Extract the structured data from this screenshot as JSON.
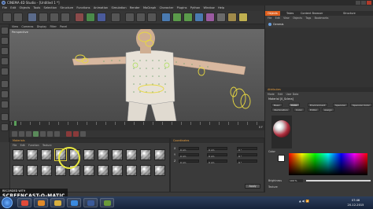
{
  "window": {
    "title": "CINEMA 4D Studio - [Untitled 1 *]",
    "colors": {
      "accent": "#e0601e",
      "background": "#3a3a3a"
    }
  },
  "menubar": [
    "File",
    "Edit",
    "Objects",
    "Tools",
    "Selection",
    "Structure",
    "Functions",
    "Animation",
    "Simulation",
    "Render",
    "MoGraph",
    "Character",
    "Plugins",
    "Python",
    "Window",
    "Help"
  ],
  "viewport": {
    "menu": [
      "View",
      "Cameras",
      "Display",
      "Filter",
      "Panel"
    ],
    "label": "Perspective"
  },
  "timeline": {
    "frame_label": "0 F"
  },
  "material_manager": {
    "header": "Materials",
    "menu": [
      "File",
      "Edit",
      "Function",
      "Texture"
    ]
  },
  "coordinates": {
    "header": "Coordinates",
    "rows": [
      {
        "axis": "X",
        "pos": "0 cm",
        "size": "0 cm",
        "rot": "0 °"
      },
      {
        "axis": "Y",
        "pos": "0 cm",
        "size": "0 cm",
        "rot": "0 °"
      },
      {
        "axis": "Z",
        "pos": "0 cm",
        "size": "0 cm",
        "rot": "0 °"
      }
    ],
    "apply_label": "Apply"
  },
  "object_manager": {
    "tabs": [
      "Objects",
      "Takes",
      "Content Browser",
      "Structure"
    ],
    "menu": [
      "File",
      "Edit",
      "View",
      "Objects",
      "Tags",
      "Bookmarks"
    ],
    "object_name": "Genesis"
  },
  "attributes": {
    "header": "Attributes",
    "menu": [
      "Mode",
      "Edit",
      "User Data"
    ],
    "material_name": "Material [0_Sclera]",
    "tabs_row1": [
      "Basic",
      "Color",
      "Environment",
      "Specular",
      "Specular Color"
    ],
    "tabs_row2": [
      "Illumination",
      "Color",
      "Editor",
      "Assign"
    ],
    "color_label": "Color",
    "brightness": {
      "label": "Brightness",
      "value": "100 %",
      "level": 1.0
    },
    "texture_label": "Texture"
  },
  "watermark": {
    "line1": "RECORDED WITH",
    "line2": "SCREENCAST-O-MATIC"
  },
  "taskbar": {
    "apps": [
      {
        "name": "chrome-icon",
        "color": "#e04a3a"
      },
      {
        "name": "firefox-icon",
        "color": "#e08a2a"
      },
      {
        "name": "folder-icon",
        "color": "#d8b040"
      },
      {
        "name": "media-icon",
        "color": "#3a8ae0"
      },
      {
        "name": "cinema4d-icon",
        "color": "#3a5a9a"
      },
      {
        "name": "app-icon",
        "color": "#6a9a3a"
      }
    ],
    "tray_text": "▲ ◀) 📶",
    "time": "07:46",
    "date": "20-12-2015"
  }
}
